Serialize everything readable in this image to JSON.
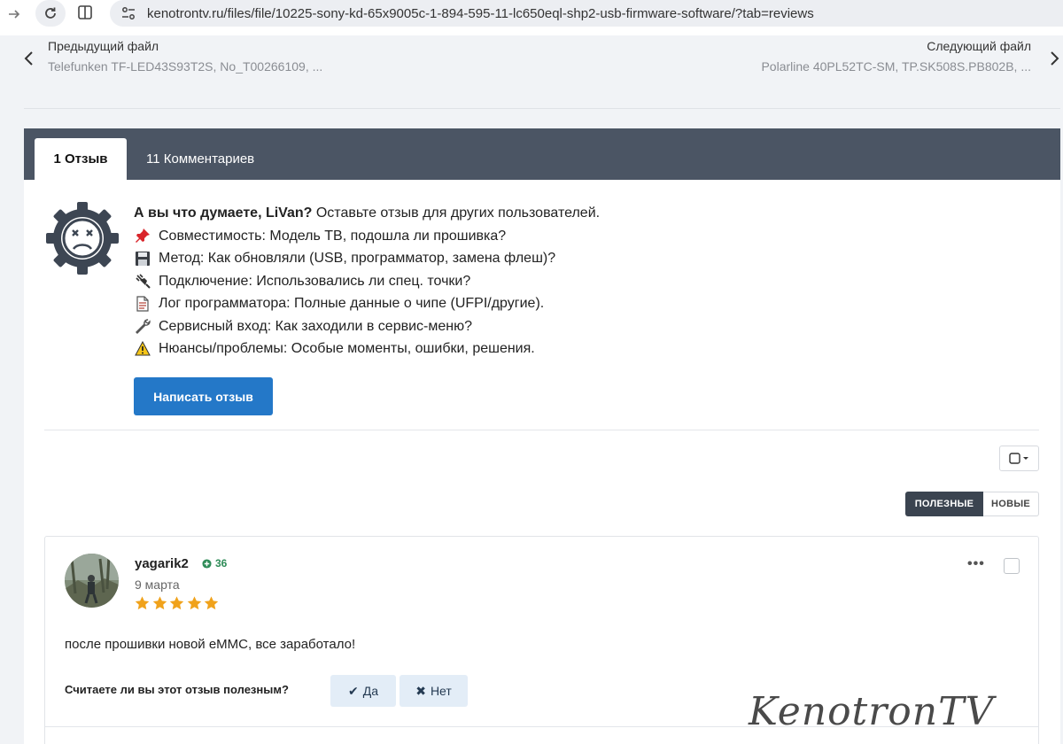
{
  "browser": {
    "url": "kenotrontv.ru/files/file/10225-sony-kd-65x9005c-1-894-595-11-lc650eql-shp2-usb-firmware-software/?tab=reviews"
  },
  "pager": {
    "prev_label": "Предыдущий файл",
    "prev_name": "Telefunken TF-LED43S93T2S, No_T00266109, ...",
    "next_label": "Следующий файл",
    "next_name": "Polarline 40PL52TC-SM, TP.SK508S.PB802B, ..."
  },
  "tabs": [
    {
      "label": "1 Отзыв",
      "active": true
    },
    {
      "label": "11 Комментариев",
      "active": false
    }
  ],
  "prompt": {
    "intro_bold": "А вы что думаете, LiVan?",
    "intro_rest": " Оставьте отзыв для других пользователей.",
    "lines": [
      {
        "icon": "pushpin-icon",
        "text": "Совместимость: Модель ТВ, подошла ли прошивка?"
      },
      {
        "icon": "floppy-disk-icon",
        "text": "Метод: Как обновляли (USB, программатор, замена флеш)?"
      },
      {
        "icon": "plug-icon",
        "text": "Подключение: Использовались ли спец. точки?"
      },
      {
        "icon": "page-icon",
        "text": "Лог программатора: Полные данные о чипе (UFPI/другие)."
      },
      {
        "icon": "wrench-icon",
        "text": "Сервисный вход: Как заходили в сервис-меню?"
      },
      {
        "icon": "warning-icon",
        "text": "Нюансы/проблемы: Особые моменты, ошибки, решения."
      }
    ],
    "write_button": "Написать отзыв"
  },
  "sort": {
    "useful": "ПОЛЕЗНЫЕ",
    "new": "НОВЫЕ",
    "active": "useful"
  },
  "review": {
    "author": "yagarik2",
    "reputation": "36",
    "date": "9 марта",
    "rating": 5,
    "text": "после прошивки новой eMMC, все заработало!",
    "helpful_question": "Считаете ли вы этот отзыв полезным?",
    "yes_label": "Да",
    "no_label": "Нет"
  },
  "watermark": "KenotronTV",
  "colors": {
    "tabbar": "#4b5564",
    "primary_button": "#2478c8",
    "star": "#f0a21b",
    "reputation": "#2e8b57"
  }
}
